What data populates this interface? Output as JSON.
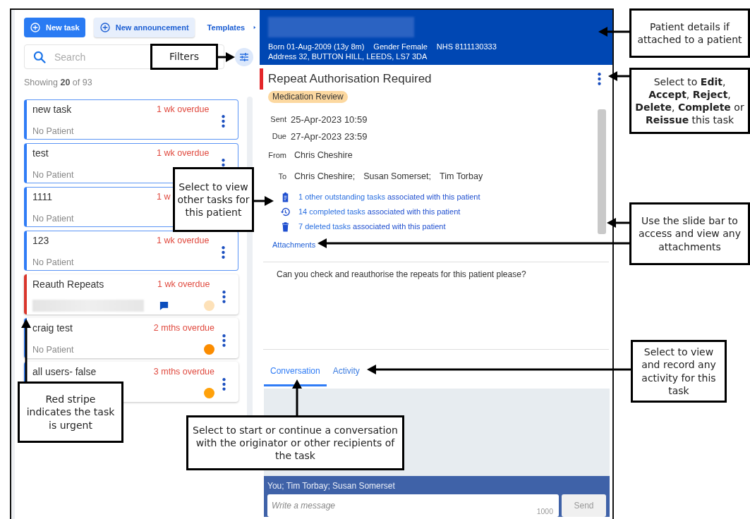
{
  "task_panel": {
    "buttons": [
      {
        "kind": "primary",
        "label": "New task"
      },
      {
        "kind": "secondary",
        "label": "New announcement"
      }
    ],
    "templates_link": "Templates",
    "search": {
      "placeholder": "Search"
    },
    "result_count": "Showing **20** of 93",
    "tasks": [
      {
        "title": "new task",
        "overdue": "1 wk overdue",
        "patient": "No Patient",
        "patient_hidden": false,
        "has_message": false,
        "menu_visible": true,
        "selected": true,
        "urgent": false
      },
      {
        "title": "test",
        "overdue": "1 wk overdue",
        "patient": "No Patient",
        "patient_hidden": false,
        "has_message": false,
        "menu_visible": true,
        "selected": true,
        "urgent": false
      },
      {
        "title": "1111",
        "overdue": "1 w",
        "patient": "No Patient",
        "patient_hidden": false,
        "has_message": false,
        "menu_visible": false,
        "selected": true,
        "urgent": false
      },
      {
        "title": "123",
        "overdue": "1 wk overdue",
        "patient": "No Patient",
        "patient_hidden": false,
        "has_message": false,
        "menu_visible": true,
        "selected": true,
        "urgent": false
      },
      {
        "title": "Reauth Repeats",
        "overdue": "1 wk overdue",
        "patient_hidden": true,
        "has_message": true,
        "menu_visible": true,
        "selected": false,
        "urgent": true,
        "color": "#fde1b8"
      },
      {
        "title": "craig test",
        "overdue": "2 mths overdue",
        "patient": "No Patient",
        "patient_hidden": false,
        "has_message": false,
        "menu_visible": true,
        "selected": false,
        "urgent": false,
        "color": "#fb8c00"
      },
      {
        "title": "all users- false",
        "overdue": "3 mths overdue",
        "patient_hidden": false,
        "has_message": false,
        "menu_visible": true,
        "selected": false,
        "urgent": false,
        "color": "#ffa10a"
      }
    ]
  },
  "patient_header": {
    "facts": [
      "Born 01-Aug-2009 (13y 8m)",
      "Gender Female",
      "NHS 8111130333"
    ],
    "address": "Address 32, BUTTON HILL, LEEDS, LS7 3DA"
  },
  "task": {
    "title": "Repeat Authorisation Required",
    "urgent": true,
    "category": "Medication Review",
    "dates": [
      {
        "label": "Sent",
        "value": "25-Apr-2023 10:59"
      },
      {
        "label": "Due",
        "value": "27-Apr-2023 23:59"
      }
    ],
    "from": {
      "label": "From",
      "value": "Chris Cheshire"
    },
    "to": {
      "label": "To",
      "recipients": [
        "Chris Cheshire;",
        "Susan Somerset;",
        "Tim Torbay"
      ]
    },
    "related": [
      {
        "kind": "outstanding",
        "link": "1 other outstanding tasks",
        "text": "associated with this patient"
      },
      {
        "kind": "completed",
        "link": "14 completed tasks",
        "text": "associated with this patient"
      },
      {
        "kind": "deleted",
        "link": "7 deleted tasks",
        "text": "associated with this patient"
      }
    ],
    "attachments_link": "Attachments",
    "message": "Can you check and reauthorise the repeats for this patient please?"
  },
  "tabs": [
    {
      "label": "Conversation",
      "selected": true
    },
    {
      "label": "Activity",
      "selected": false
    }
  ],
  "composer": {
    "participants": "You; Tim Torbay; Susan Somerset",
    "placeholder": "Write a message",
    "counter": "1000",
    "send": {
      "label": "Send",
      "disabled": true
    }
  },
  "callouts": [
    {
      "text": "Filters"
    },
    {
      "text": "Select to view other tasks for this patient"
    },
    {
      "text": "Red stripe indicates the task is urgent"
    },
    {
      "text": "Select to start or continue a conversation with the originator or other recipients of the task"
    },
    {
      "text": "Patient details if attached to a patient"
    },
    {
      "text": "Select to **Edit**, **Accept**, **Reject**, **Delete**, **Complete** or **Reissue** this task"
    },
    {
      "text": "Use the slide bar to access and view any attachments"
    },
    {
      "text": "Select to view and record any activity for this task"
    }
  ]
}
